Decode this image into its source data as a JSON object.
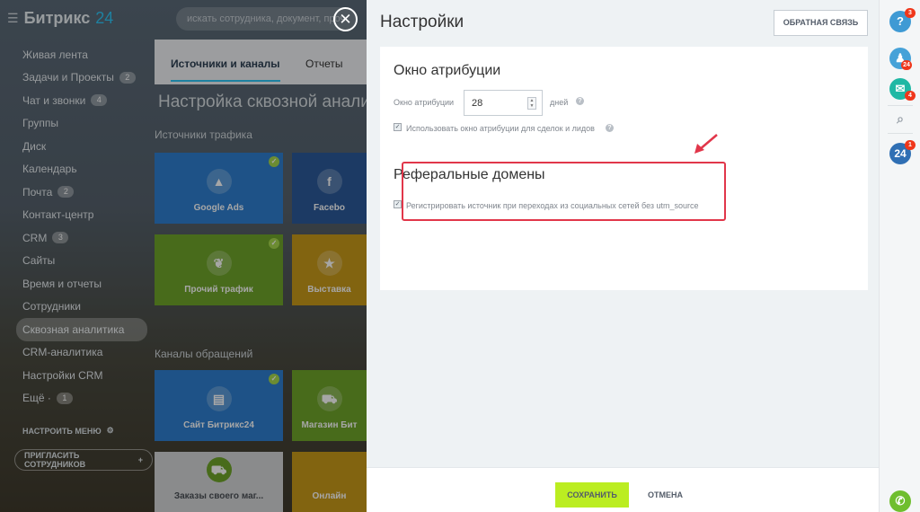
{
  "app": {
    "logo_text": "Битрикс",
    "logo_num": "24"
  },
  "sidebar": {
    "items": [
      {
        "label": "Живая лента",
        "badge": ""
      },
      {
        "label": "Задачи и Проекты",
        "badge": "2"
      },
      {
        "label": "Чат и звонки",
        "badge": "4"
      },
      {
        "label": "Группы",
        "badge": ""
      },
      {
        "label": "Диск",
        "badge": ""
      },
      {
        "label": "Календарь",
        "badge": ""
      },
      {
        "label": "Почта",
        "badge": "2"
      },
      {
        "label": "Контакт-центр",
        "badge": ""
      },
      {
        "label": "CRM",
        "badge": "3"
      },
      {
        "label": "Сайты",
        "badge": ""
      },
      {
        "label": "Время и отчеты",
        "badge": ""
      },
      {
        "label": "Сотрудники",
        "badge": ""
      },
      {
        "label": "Сквозная аналитика",
        "badge": ""
      },
      {
        "label": "CRM-аналитика",
        "badge": ""
      },
      {
        "label": "Настройки CRM",
        "badge": ""
      },
      {
        "label": "Ещё ·",
        "badge": "1"
      }
    ],
    "configure_menu": "НАСТРОИТЬ МЕНЮ",
    "invite": "ПРИГЛАСИТЬ СОТРУДНИКОВ"
  },
  "search": {
    "placeholder": "искать сотрудника, документ, проч"
  },
  "background": {
    "tabs": [
      "Источники и каналы",
      "Отчеты"
    ],
    "title": "Настройка сквозной анали",
    "traffic_label": "Источники трафика",
    "channels_label": "Каналы обращений",
    "tiles": [
      "Google Ads",
      "Facebo",
      "Прочий трафик",
      "Выставка",
      "Сайт Битрикс24",
      "Магазин Бит",
      "Заказы своего маг...",
      "Онлайн"
    ]
  },
  "panel": {
    "title": "Настройки",
    "feedback_button": "ОБРАТНАЯ СВЯЗЬ",
    "attribution": {
      "heading": "Окно атрибуции",
      "field_label": "Окно атрибуции",
      "value": "28",
      "unit": "дней",
      "checkbox_label": "Использовать окно атрибуции для сделок и лидов"
    },
    "referral": {
      "heading": "Реферальные домены",
      "checkbox_label": "Регистрировать источник при переходах из социальных сетей без utm_source"
    },
    "save_button": "СОХРАНИТЬ",
    "cancel_button": "ОТМЕНА"
  },
  "rail": {
    "help_badge": "3",
    "notify_badge": "24",
    "chat_badge": "4",
    "b24_badge": "1",
    "b24_label": "24"
  },
  "colors": {
    "accent": "#2fc6f6",
    "save": "#bbed21",
    "highlight": "#e1364a"
  }
}
